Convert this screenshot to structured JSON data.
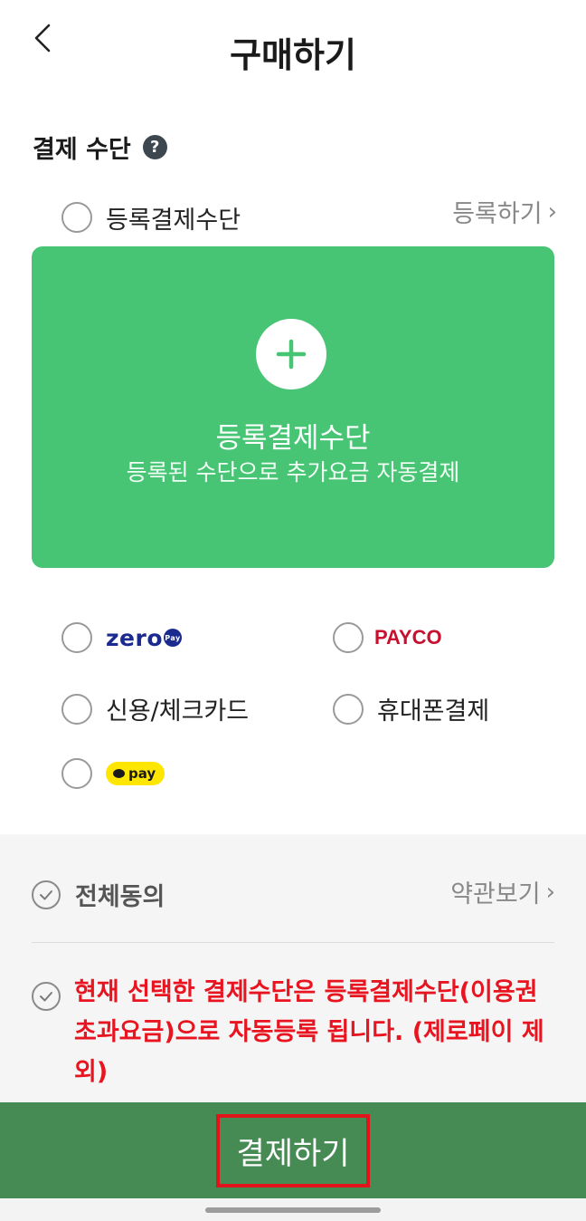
{
  "header": {
    "title": "구매하기"
  },
  "payment_method": {
    "title": "결제 수단",
    "help_glyph": "?",
    "registered": {
      "label": "등록결제수단",
      "register_link": "등록하기",
      "chevron": "›"
    },
    "card": {
      "title": "등록결제수단",
      "subtitle": "등록된 수단으로 추가요금 자동결제"
    },
    "options": [
      {
        "name": "zero-pay",
        "logo_text": "zero",
        "logo_badge": "Pay"
      },
      {
        "name": "payco",
        "logo_text": "PAYCO"
      },
      {
        "name": "credit-check-card",
        "label": "신용/체크카드"
      },
      {
        "name": "mobile-payment",
        "label": "휴대폰결제"
      },
      {
        "name": "kakao-pay",
        "logo_text": "pay"
      }
    ]
  },
  "agreement": {
    "agree_all": "전체동의",
    "terms_link": "약관보기",
    "chevron": "›",
    "notice": "현재 선택한 결제수단은 등록결제수단(이용권 초과요금)으로 자동등록 됩니다. (제로페이 제외)"
  },
  "footer": {
    "pay_button": "결제하기"
  },
  "colors": {
    "card_green": "#47c574",
    "pay_bar_green": "#468a54",
    "notice_red": "#e8141f",
    "highlight_border": "#e1141b"
  }
}
